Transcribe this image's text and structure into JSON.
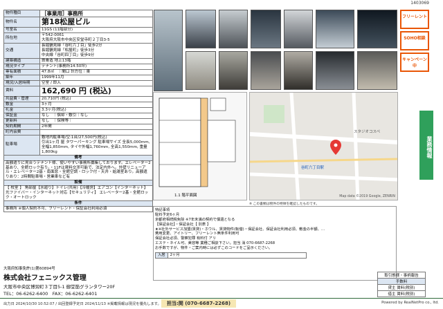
{
  "doc_code": "1403069",
  "spec": {
    "rows": [
      {
        "k": "物件種目",
        "v": "［事業用］事務所",
        "cls": "mid"
      },
      {
        "k": "物件名",
        "v": "第18松屋ビル",
        "cls": "big"
      },
      {
        "k": "号室名",
        "v": "11GS (11階部分)"
      },
      {
        "k": "所在地",
        "v": "〒542-0061\n大阪府大阪市中央区安堂寺町２丁目3-5"
      },
      {
        "k": "交通",
        "v": "長堀鶴見緑「谷町六丁目」徒歩2分\n長堀鶴見緑「松屋町」徒歩3分\n中央線「谷町四丁目」徒歩9分"
      },
      {
        "k": "建築構造",
        "v": "鉄骨造 地上13階"
      },
      {
        "k": "現況タイプ",
        "v": "テナント(事務所14.50坪)"
      },
      {
        "k": "専有面積",
        "v": "47.8㎡　｜間口 計方位｜東"
      },
      {
        "k": "築年",
        "v": "1999年11月"
      },
      {
        "k": "現況/入居時期",
        "v": "空室 / 即入"
      },
      {
        "k": "賃料",
        "v": "162,690 円 (税込)",
        "cls": "rent"
      },
      {
        "k": "共益費・管理",
        "v": "20,710円 (税込)"
      },
      {
        "k": "敷金",
        "v": "3ヶ月"
      },
      {
        "k": "礼金",
        "v": "3.3ヶ月(税込)"
      },
      {
        "k": "保証金",
        "v": "なし　｜償却・敷引｜なし"
      },
      {
        "k": "更新料",
        "v": "なし　｜保険等｜"
      },
      {
        "k": "契約期間",
        "v": "2年間"
      },
      {
        "k": "町内会費",
        "v": ""
      },
      {
        "k": "駐車場",
        "v": "敷地内駐車場/空:1台/27,500円(税込)\n引出1ヶ月 屋 タワーパーキング 駐車場サイズ 全長5,000mm, 全幅1,850mm, タイヤ外幅1,760mm, 全高1,550mm, 重量1,800kg"
      }
    ],
    "notes_head": "備考",
    "notes": "高額遣りに見合うテナント様、使いやすい事務所募集しております。エレベーター2基あり、全館ロック有り。・11Fは賃料交渉可能で、法定内外へ。外壁リニューアル・エレベーター2基・南面窓・全館空調・ロック付・天井・給湯室あり。高額遣りあり：2時間駐車場・営業車など有",
    "equip_head": "設備",
    "equip": "【 校室 】 角部屋【水廻り】トイレ(共用)【冷暖房】エアコン【インターネット】 光ファイバー・インターネット対応【セキュリティ】 エレベーター2基・全館ロック・オートロック",
    "cond_head": "条件",
    "cond": "事務所 ※個人契約不可、フリーレント・保証会社利用必須"
  },
  "sidebar": {
    "tags": [
      "フリーレント",
      "SOHO相談",
      "キャンペーン中"
    ],
    "vertical": "業務情報"
  },
  "floor": {
    "caption": "1.1 階平面図"
  },
  "map": {
    "station": "谷町六丁目駅",
    "landmark": "スタジオコスペ",
    "copyright": "Map data ©2019 Google, ZENRIN"
  },
  "note": {
    "text": "特記事項\n駐料予定6ヶ月\n京都府相続税免除 ※7年未満の契約で償還となる\n【保証会社】・保証会社【 別表 】\n★※社外サービス加盟(賃貸)・ホウル、賃貸物件(転借)・保証会社、保証会社利用必須、敷金の半額、…\n費用変更、アイトリー、フリーレント無条件利用可\n保証会社必須、警察犯罪 有料付 アリ\nエステ・ネイル可、美容等 業種ご相談下さい。担当 消 070-6687-2268\nお手数ですが、物件・ご案内時には必ずこのコードをご呈示ください。",
    "rows": [
      {
        "k": "入居",
        "v": "2ヶ月"
      }
    ],
    "contact": "担当:関 (070-6687-2268)"
  },
  "company": {
    "license": "大阪府知事免許(1)第60894号",
    "name": "株式会社フェニックス管理",
    "addr": "大阪市中央区博労町３丁目5-1 御堂筋グランタワー20F",
    "tel": "TEL：06-6262-6400　FAX：06-6262-6401"
  },
  "fee": {
    "head": "取引態様・事柄報告",
    "sub": "手数料",
    "rows": [
      "貸主 賃料(税別)",
      "借主 賃料(税別)"
    ]
  },
  "footer": {
    "left": "出力日 2024/10/30 10:52:07 / 出回登録予定日 2024/11/13 ※掲載情報は現況を優先します。",
    "contact": "担当:関 (070-6687-2268)",
    "right": "Powered by RealNetPro co., ltd."
  }
}
